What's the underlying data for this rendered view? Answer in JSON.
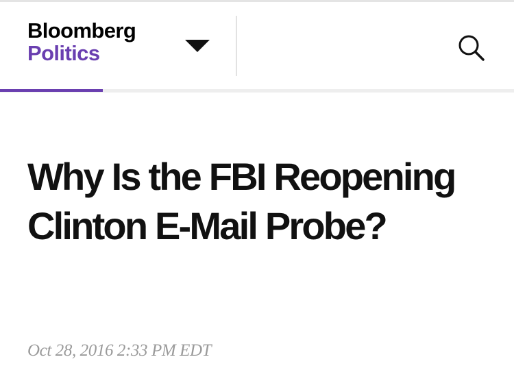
{
  "header": {
    "brand": "Bloomberg",
    "section": "Politics",
    "section_color": "#6a3fb0",
    "dropdown_icon": "caret-down-icon",
    "search_icon": "search-icon"
  },
  "nav": {
    "indicator_color": "#6a3fb0"
  },
  "article": {
    "headline": "Why Is the FBI Reopening Clinton E-Mail Probe?",
    "timestamp": "Oct 28, 2016 2:33 PM EDT"
  }
}
